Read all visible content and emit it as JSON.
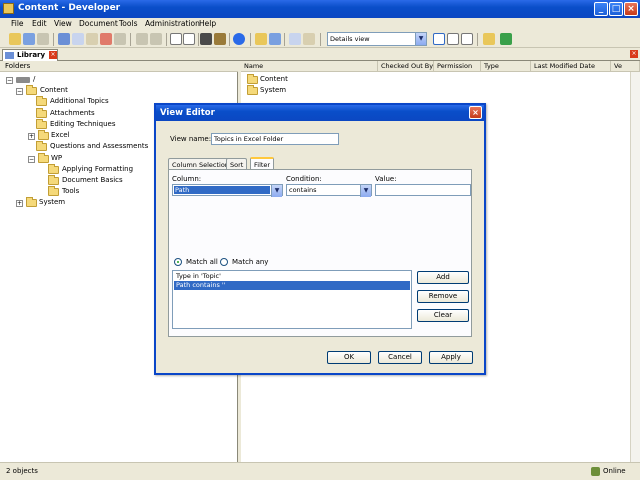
{
  "window": {
    "title": "Content - Developer"
  },
  "menu": [
    "File",
    "Edit",
    "View",
    "Document",
    "Tools",
    "Administration",
    "Help"
  ],
  "toolbar": {
    "view_select_value": "Details view"
  },
  "tabs": {
    "library_label": "Library"
  },
  "folders": {
    "header": "Folders",
    "root_label": "/",
    "items": [
      {
        "label": "Content"
      },
      {
        "label": "Additional Topics"
      },
      {
        "label": "Attachments"
      },
      {
        "label": "Editing Techniques"
      },
      {
        "label": "Excel"
      },
      {
        "label": "Questions and Assessments"
      },
      {
        "label": "WP"
      },
      {
        "label": "Applying Formatting"
      },
      {
        "label": "Document Basics"
      },
      {
        "label": "Tools"
      },
      {
        "label": "System"
      }
    ]
  },
  "list": {
    "columns": [
      "Name",
      "Checked Out By",
      "Permission",
      "Type",
      "Last Modified Date",
      "Ve"
    ],
    "rows": [
      {
        "name": "Content"
      },
      {
        "name": "System"
      }
    ]
  },
  "status": {
    "count": "2 objects",
    "connection": "Online"
  },
  "dialog": {
    "title": "View Editor",
    "view_name_label": "View name:",
    "view_name_value": "Topics in Excel Folder",
    "tabs": [
      "Column Selection",
      "Sort",
      "Filter"
    ],
    "active_tab": "Filter",
    "column_label": "Column:",
    "column_value": "Path",
    "condition_label": "Condition:",
    "condition_value": "contains",
    "value_label": "Value:",
    "value_value": "",
    "match_all": "Match all",
    "match_any": "Match any",
    "match_selected": "Match all",
    "filters": [
      "Type in 'Topic'",
      "Path contains ''"
    ],
    "buttons": {
      "add": "Add",
      "remove": "Remove",
      "clear": "Clear",
      "ok": "OK",
      "cancel": "Cancel",
      "apply": "Apply"
    }
  }
}
